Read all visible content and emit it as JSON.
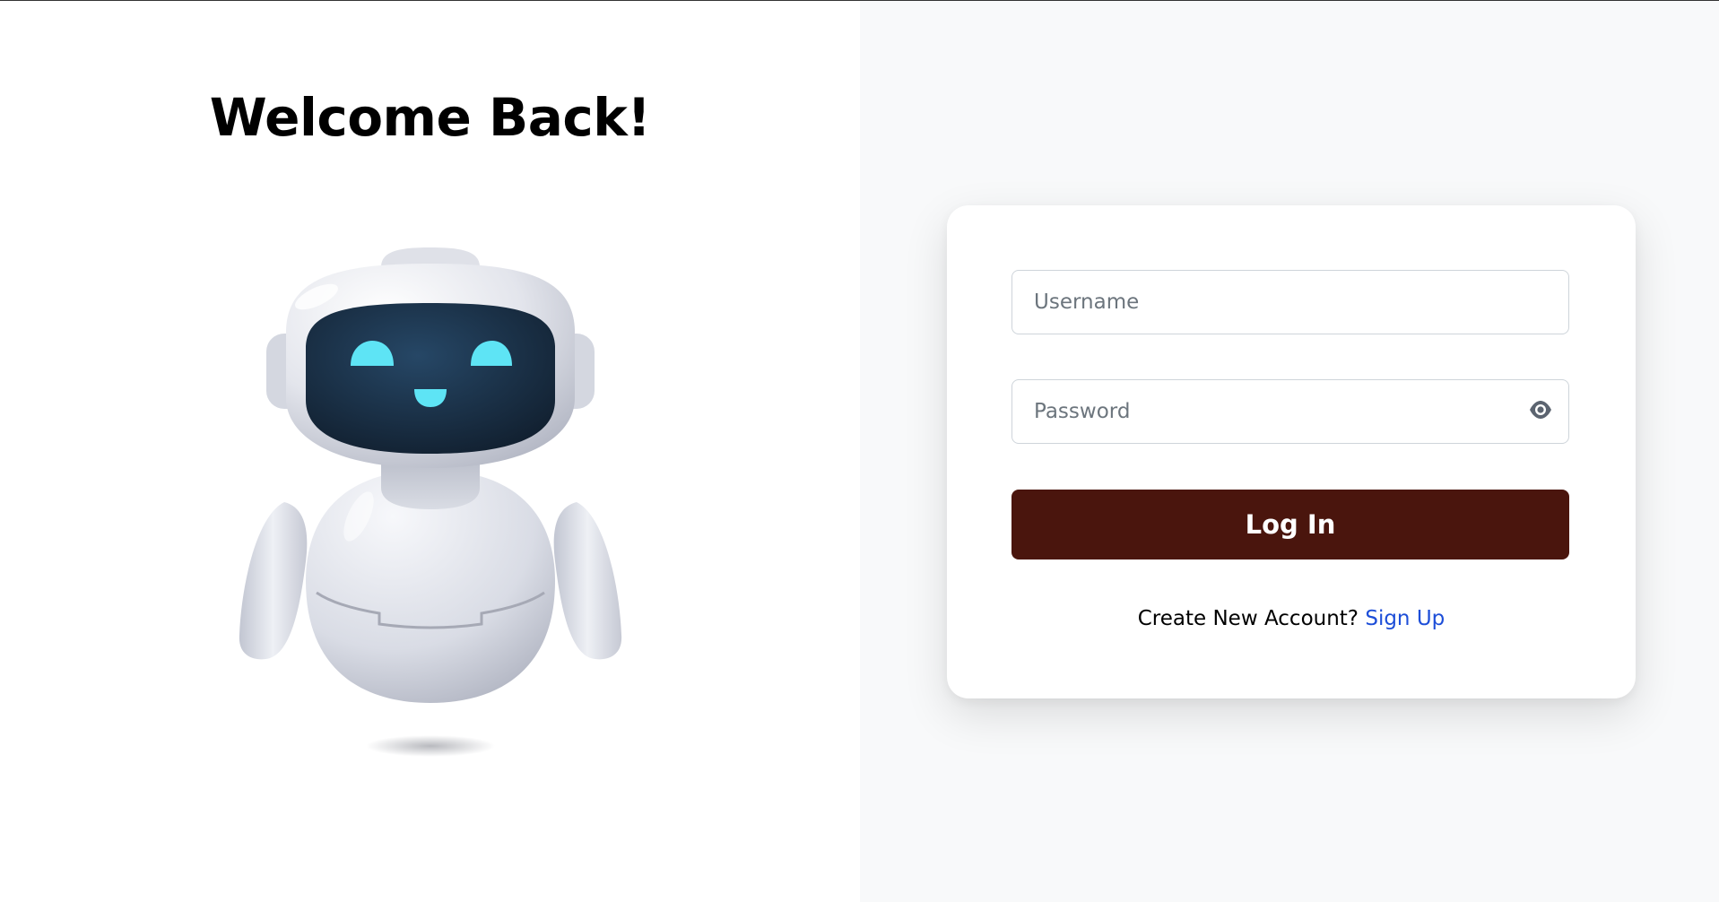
{
  "left_panel": {
    "title": "Welcome Back!",
    "illustration": "robot-mascot"
  },
  "login_form": {
    "username": {
      "placeholder": "Username",
      "value": ""
    },
    "password": {
      "placeholder": "Password",
      "value": "",
      "toggle_icon": "eye-icon"
    },
    "submit_label": "Log In",
    "signup_prompt": "Create New Account?",
    "signup_link": "Sign Up"
  },
  "colors": {
    "left_background": "#ffffff",
    "right_background": "#f8f9fa",
    "button_background": "#4a150d",
    "link": "#1d4ed8",
    "robot_eyes": "#5ee4f5",
    "robot_visor": "#14263a"
  }
}
